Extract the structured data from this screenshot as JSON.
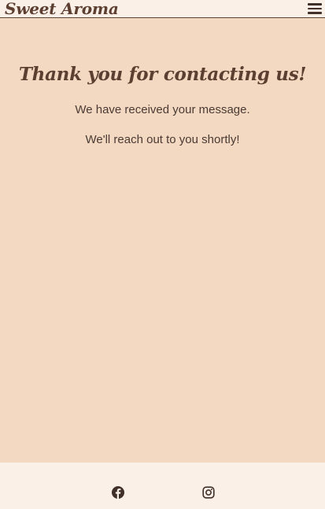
{
  "navbar": {
    "brand": "Sweet Aroma",
    "menu_icon": "hamburger-menu-icon"
  },
  "main": {
    "heading": "Thank you for contacting us!",
    "message_received": "We have received your message.",
    "message_followup": "We'll reach out to you shortly!"
  },
  "footer": {
    "social_links": [
      {
        "icon": "facebook-icon"
      },
      {
        "icon": "instagram-icon"
      }
    ]
  },
  "colors": {
    "page_background": "#f3d9c1",
    "bar_background": "#faf0e7",
    "brand_text": "#5c3f31",
    "body_text": "#4a3a33"
  }
}
